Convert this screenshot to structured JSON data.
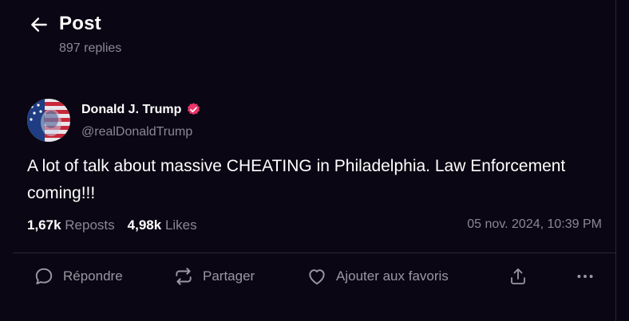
{
  "header": {
    "title": "Post",
    "replies": "897 replies",
    "back_icon": "arrow-left-icon"
  },
  "post": {
    "author_name": "Donald J. Trump",
    "author_handle": "@realDonaldTrump",
    "verified": true,
    "text": "A lot of talk about massive CHEATING in Philadelphia. Law Enforcement coming!!!",
    "reposts_count": "1,67k",
    "reposts_label": "Reposts",
    "likes_count": "4,98k",
    "likes_label": "Likes",
    "timestamp": "05 nov. 2024, 10:39 PM"
  },
  "actions": {
    "reply_label": "Répondre",
    "share_label": "Partager",
    "favorite_label": "Ajouter aux favoris",
    "upload_icon": "share-upload-icon",
    "more_icon": "more-dots-icon"
  },
  "colors": {
    "background": "#0a0613",
    "text": "#ffffff",
    "muted": "#8b8896",
    "verified_badge": "#e8366a",
    "divider": "#2a2733"
  }
}
